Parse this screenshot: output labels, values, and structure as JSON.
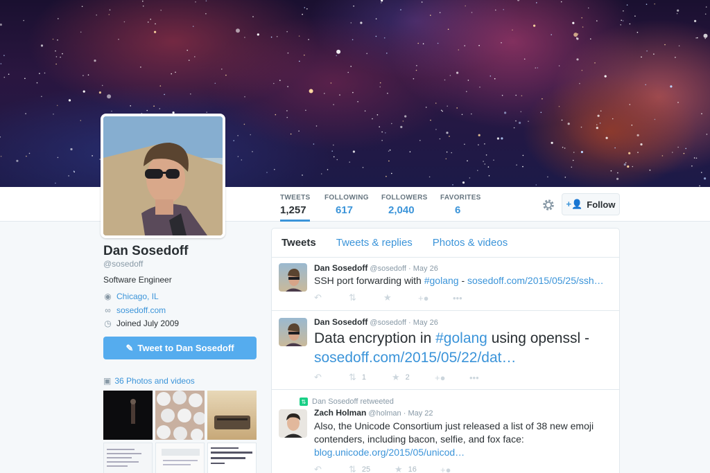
{
  "profile": {
    "name": "Dan Sosedoff",
    "handle": "@sosedoff",
    "bio": "Software Engineer",
    "location": "Chicago, IL",
    "website": "sosedoff.com",
    "joined": "Joined July 2009",
    "tweet_to_label": "Tweet to Dan Sosedoff",
    "photos_label": "36 Photos and videos"
  },
  "stats": [
    {
      "label": "TWEETS",
      "value": "1,257"
    },
    {
      "label": "FOLLOWING",
      "value": "617"
    },
    {
      "label": "FOLLOWERS",
      "value": "2,040"
    },
    {
      "label": "FAVORITES",
      "value": "6"
    }
  ],
  "follow_label": "Follow",
  "tabs": [
    "Tweets",
    "Tweets & replies",
    "Photos & videos"
  ],
  "tweets": [
    {
      "name": "Dan Sosedoff",
      "handle": "@sosedoff",
      "time": "May 26",
      "text_pre": "SSH port forwarding with ",
      "hashtag": "#golang",
      "text_mid": " - ",
      "link": "sosedoff.com/2015/05/25/ssh…",
      "retweets": "",
      "favorites": ""
    },
    {
      "name": "Dan Sosedoff",
      "handle": "@sosedoff",
      "time": "May 26",
      "text_pre": "Data encryption in ",
      "hashtag": "#golang",
      "text_mid": " using openssl - ",
      "link": "sosedoff.com/2015/05/22/dat…",
      "retweets": "1",
      "favorites": "2"
    },
    {
      "retweet_note": "Dan Sosedoff retweeted",
      "name": "Zach Holman",
      "handle": "@holman",
      "time": "May 22",
      "text": "Also, the Unicode Consortium just released a list of 38 new emoji contenders, including bacon, selfie, and fox face:",
      "link": "blog.unicode.org/2015/05/unicod…",
      "retweets": "25",
      "favorites": "16"
    }
  ],
  "dot": "·",
  "icons": {
    "reply": "reply-icon",
    "retweet": "retweet-icon",
    "favorite": "star-icon",
    "follow": "follow-icon",
    "more": "more-icon",
    "gear": "gear-icon",
    "location": "location-pin-icon",
    "link": "link-icon",
    "clock": "clock-icon",
    "camera": "camera-icon",
    "compose": "compose-icon"
  },
  "colors": {
    "accent": "#3b94d9",
    "button_blue": "#55acee",
    "retweet_green": "#19cf86"
  }
}
